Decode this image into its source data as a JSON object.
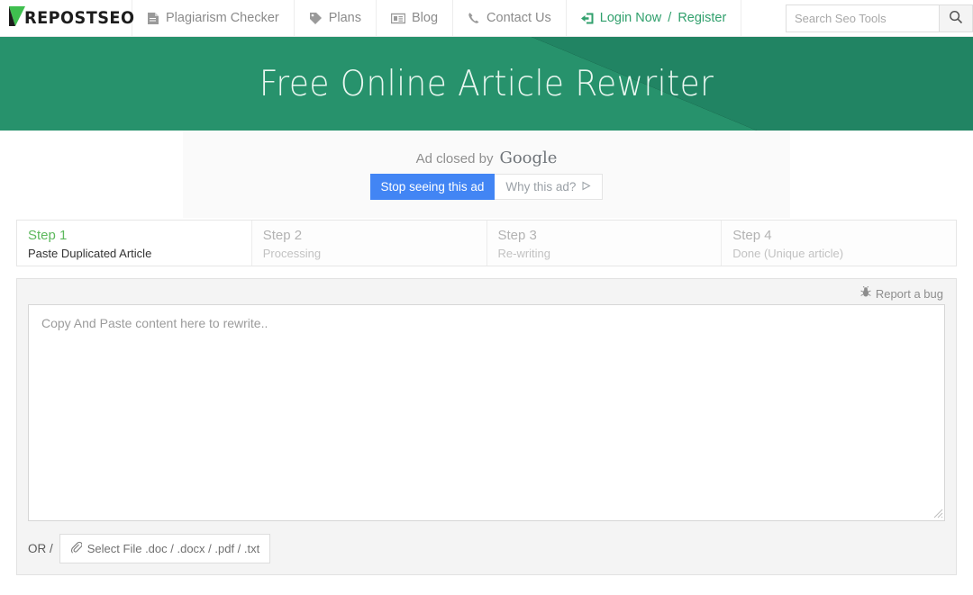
{
  "brand": {
    "name": "REPOSTSEO",
    "accent_green": "#3fbf4f"
  },
  "nav": {
    "items": [
      {
        "label": "Plagiarism Checker",
        "icon": "document-icon"
      },
      {
        "label": "Plans",
        "icon": "tag-icon"
      },
      {
        "label": "Blog",
        "icon": "newspaper-icon"
      },
      {
        "label": "Contact Us",
        "icon": "phone-icon"
      }
    ],
    "login": {
      "login_label": "Login Now",
      "separator": "/",
      "register_label": "Register",
      "icon": "sign-in-icon"
    }
  },
  "search": {
    "placeholder": "Search Seo Tools",
    "value": "",
    "icon": "search-icon"
  },
  "banner": {
    "title": "Free Online Article Rewriter",
    "bg_color": "#27926c",
    "shape_color": "#22866"
  },
  "ad": {
    "closed_text": "Ad closed by",
    "provider": "Google",
    "stop_label": "Stop seeing this ad",
    "why_label": "Why this ad?",
    "why_icon": "play-triangle-icon",
    "stop_color": "#4285f4"
  },
  "steps": [
    {
      "title": "Step 1",
      "subtitle": "Paste Duplicated Article",
      "active": true
    },
    {
      "title": "Step 2",
      "subtitle": "Processing",
      "active": false
    },
    {
      "title": "Step 3",
      "subtitle": "Re-writing",
      "active": false
    },
    {
      "title": "Step 4",
      "subtitle": "Done (Unique article)",
      "active": false
    }
  ],
  "editor": {
    "report_bug_label": "Report a bug",
    "report_bug_icon": "bug-icon",
    "textarea_placeholder": "Copy And Paste content here to rewrite..",
    "textarea_value": "",
    "or_label": "OR /",
    "file_button_label": "Select File .doc / .docx / .pdf / .txt",
    "file_button_icon": "paperclip-icon"
  }
}
